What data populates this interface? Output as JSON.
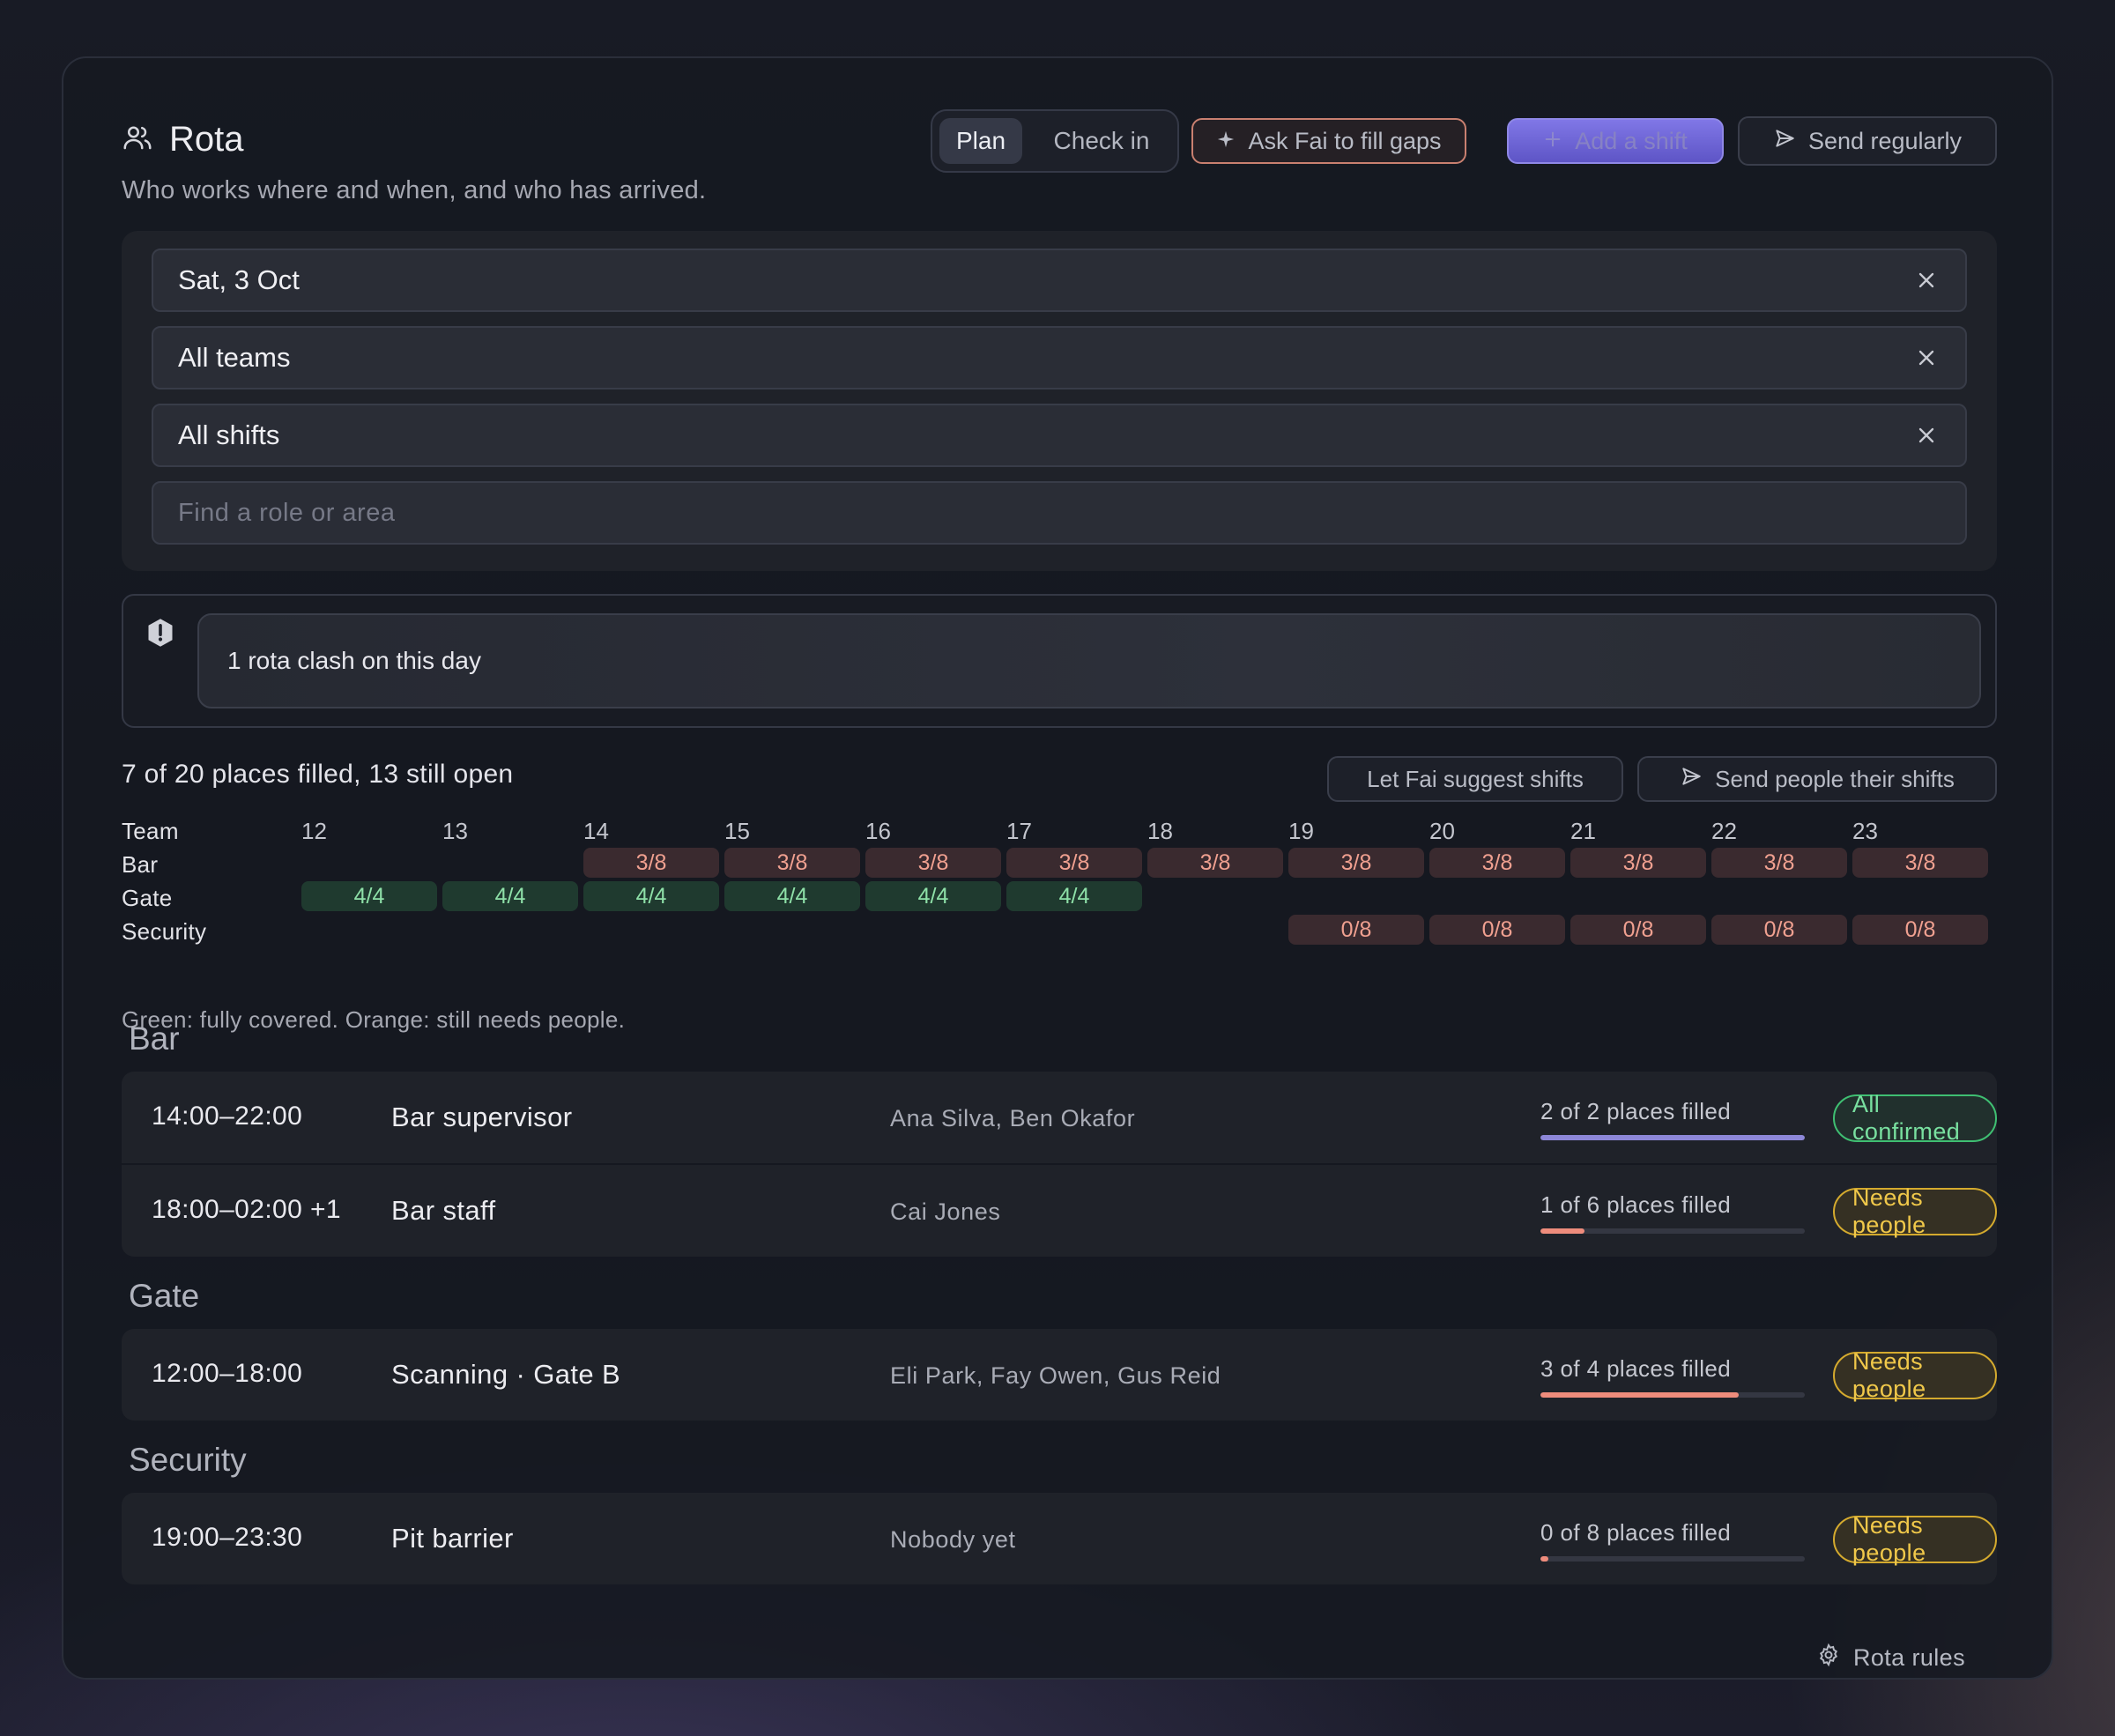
{
  "header": {
    "title": "Rota",
    "subtitle": "Who works where and when, and who has arrived.",
    "mode_tabs": [
      {
        "label": "Plan",
        "active": true
      },
      {
        "label": "Check in",
        "active": false
      }
    ],
    "ask_fai_label": "Ask Fai to fill gaps",
    "add_shift_label": "Add a shift",
    "send_regularly_label": "Send regularly"
  },
  "filters": {
    "date": "Sat, 3 Oct",
    "team": "All teams",
    "shift": "All shifts",
    "search_placeholder": "Find a role or area"
  },
  "alert": {
    "text": "1 rota clash on this day"
  },
  "summary": {
    "text": "7 of 20 places filled, 13 still open",
    "suggest_label": "Let Fai suggest shifts",
    "send_label": "Send people their shifts"
  },
  "coverage": {
    "team_header": "Team",
    "hours": [
      "12",
      "13",
      "14",
      "15",
      "16",
      "17",
      "18",
      "19",
      "20",
      "21",
      "22",
      "23"
    ],
    "rows": [
      {
        "team": "Bar",
        "start": 2,
        "cells": [
          "3/8",
          "3/8",
          "3/8",
          "3/8",
          "3/8",
          "3/8",
          "3/8",
          "3/8",
          "3/8",
          "3/8"
        ],
        "status": "open"
      },
      {
        "team": "Gate",
        "start": 0,
        "cells": [
          "4/4",
          "4/4",
          "4/4",
          "4/4",
          "4/4",
          "4/4"
        ],
        "status": "full"
      },
      {
        "team": "Security",
        "start": 7,
        "cells": [
          "0/8",
          "0/8",
          "0/8",
          "0/8",
          "0/8"
        ],
        "status": "open"
      }
    ],
    "legend": "Green: fully covered. Orange: still needs people."
  },
  "groups": [
    {
      "name": "Bar",
      "shifts": [
        {
          "time": "14:00–22:00",
          "role": "Bar supervisor",
          "people": "Ana Silva, Ben Okafor",
          "filled_text": "2 of 2 places filled",
          "progress": 1.0,
          "status": "All confirmed",
          "status_kind": "ok"
        },
        {
          "time": "18:00–02:00 +1",
          "role": "Bar staff",
          "people": "Cai Jones",
          "filled_text": "1 of 6 places filled",
          "progress": 0.167,
          "status": "Needs people",
          "status_kind": "need"
        }
      ]
    },
    {
      "name": "Gate",
      "shifts": [
        {
          "time": "12:00–18:00",
          "role": "Scanning · Gate B",
          "people": "Eli Park, Fay Owen, Gus Reid",
          "filled_text": "3 of 4 places filled",
          "progress": 0.75,
          "status": "Needs people",
          "status_kind": "need"
        }
      ]
    },
    {
      "name": "Security",
      "shifts": [
        {
          "time": "19:00–23:30",
          "role": "Pit barrier",
          "people": "Nobody yet",
          "filled_text": "0 of 8 places filled",
          "progress": 0.0,
          "status": "Needs people",
          "status_kind": "need"
        }
      ]
    }
  ],
  "footer": {
    "rules_label": "Rota rules"
  },
  "colors": {
    "accent": "#7c70e0",
    "progress_full": "#8d87d8",
    "progress_partial": "#ee8c7c",
    "ok": "#3fbf72",
    "need": "#d4aa2e"
  },
  "icons": [
    "users-icon",
    "sparkle-icon",
    "plus-icon",
    "send-icon",
    "close-icon",
    "shield-alert-icon",
    "gear-icon"
  ]
}
